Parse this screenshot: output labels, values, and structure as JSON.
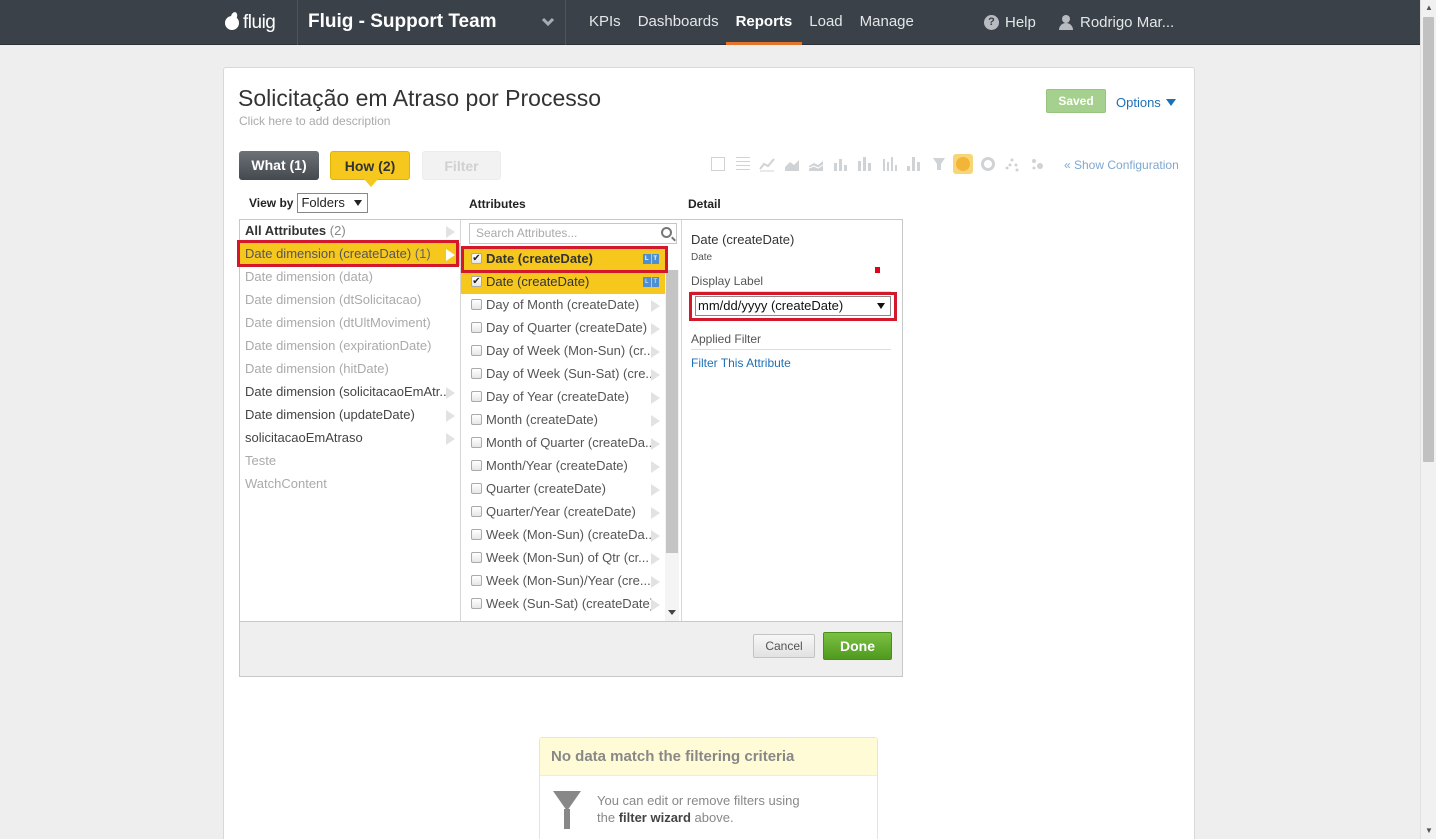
{
  "header": {
    "logo_text": "fluig",
    "team_title": "Fluig - Support Team",
    "nav": [
      "KPIs",
      "Dashboards",
      "Reports",
      "Load",
      "Manage"
    ],
    "active_nav": "Reports",
    "help": "Help",
    "user": "Rodrigo Mar..."
  },
  "report": {
    "title": "Solicitação em Atraso por Processo",
    "description": "Click here to add description",
    "saved_label": "Saved",
    "options_label": "Options"
  },
  "steps": {
    "what": "What (1)",
    "how": "How (2)",
    "filter": "Filter"
  },
  "chart_types": [
    "table-icon",
    "grid-icon",
    "line-icon",
    "area-icon",
    "stacked-area-icon",
    "bar-icon",
    "stacked-bar-icon",
    "column-icon",
    "bubble-icon",
    "funnel-icon",
    "pie-icon",
    "donut-icon",
    "scatter-icon",
    "heat-icon"
  ],
  "selected_chart_type": "pie-icon",
  "show_configuration": "« Show Configuration",
  "columns": {
    "view_by_label": "View by",
    "view_by_value": "Folders",
    "attributes_label": "Attributes",
    "detail_label": "Detail"
  },
  "folders": [
    {
      "label": "All Attributes",
      "count": "(2)"
    },
    {
      "label": "Date dimension (createDate)",
      "count": "(1)"
    },
    {
      "label": "Date dimension (data)",
      "count": ""
    },
    {
      "label": "Date dimension (dtSolicitacao)",
      "count": ""
    },
    {
      "label": "Date dimension (dtUltMoviment)",
      "count": ""
    },
    {
      "label": "Date dimension (expirationDate)",
      "count": ""
    },
    {
      "label": "Date dimension (hitDate)",
      "count": ""
    },
    {
      "label": "Date dimension (solicitacaoEmAtr...",
      "count": ""
    },
    {
      "label": "Date dimension (updateDate)",
      "count": ""
    },
    {
      "label": "solicitacaoEmAtraso",
      "count": ""
    },
    {
      "label": "Teste",
      "count": ""
    },
    {
      "label": "WatchContent",
      "count": ""
    }
  ],
  "attributes": {
    "search_placeholder": "Search Attributes...",
    "items": [
      {
        "label": "Date (createDate)",
        "checked": true
      },
      {
        "label": "Date (createDate)",
        "checked": true
      },
      {
        "label": "Day of Month (createDate)",
        "checked": false
      },
      {
        "label": "Day of Quarter (createDate)",
        "checked": false
      },
      {
        "label": "Day of Week (Mon-Sun) (cr...",
        "checked": false
      },
      {
        "label": "Day of Week (Sun-Sat) (cre...",
        "checked": false
      },
      {
        "label": "Day of Year (createDate)",
        "checked": false
      },
      {
        "label": "Month (createDate)",
        "checked": false
      },
      {
        "label": "Month of Quarter (createDa...",
        "checked": false
      },
      {
        "label": "Month/Year (createDate)",
        "checked": false
      },
      {
        "label": "Quarter (createDate)",
        "checked": false
      },
      {
        "label": "Quarter/Year (createDate)",
        "checked": false
      },
      {
        "label": "Week (Mon-Sun) (createDa...",
        "checked": false
      },
      {
        "label": "Week (Mon-Sun) of Qtr (cr...",
        "checked": false
      },
      {
        "label": "Week (Mon-Sun)/Year (cre...",
        "checked": false
      },
      {
        "label": "Week (Sun-Sat) (createDate)",
        "checked": false
      }
    ]
  },
  "detail": {
    "name": "Date (createDate)",
    "type": "Date",
    "display_label": "Display Label",
    "display_value": "mm/dd/yyyy (createDate)",
    "applied_filter": "Applied Filter",
    "filter_link": "Filter This Attribute"
  },
  "footer": {
    "cancel": "Cancel",
    "done": "Done"
  },
  "nodata": {
    "title": "No data match the filtering criteria",
    "line1": "You can edit or remove filters using",
    "line2_pre": "the ",
    "line2_bold": "filter wizard",
    "line2_post": " above."
  }
}
